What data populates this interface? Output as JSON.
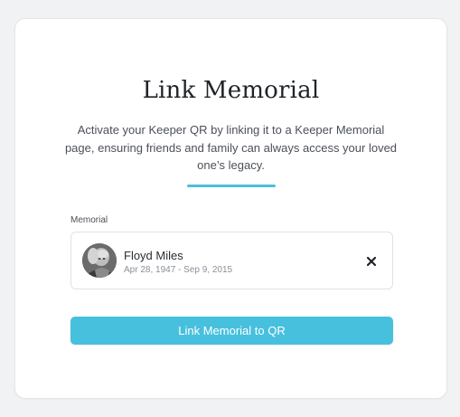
{
  "title": "Link Memorial",
  "description": "Activate your Keeper QR by linking it to a Keeper Memorial page, ensuring friends and family can always access your loved one’s legacy.",
  "memorial_field": {
    "label": "Memorial",
    "selected": {
      "name": "Floyd Miles",
      "dates": "Apr 28, 1947 - Sep 9, 2015",
      "avatar_icon": "portrait-photo",
      "clear_icon": "close-icon"
    }
  },
  "submit_button": {
    "label": "Link Memorial to QR"
  },
  "colors": {
    "accent": "#47c0de",
    "divider": "#4bbde0",
    "background": "#f1f2f4",
    "card": "#ffffff"
  }
}
